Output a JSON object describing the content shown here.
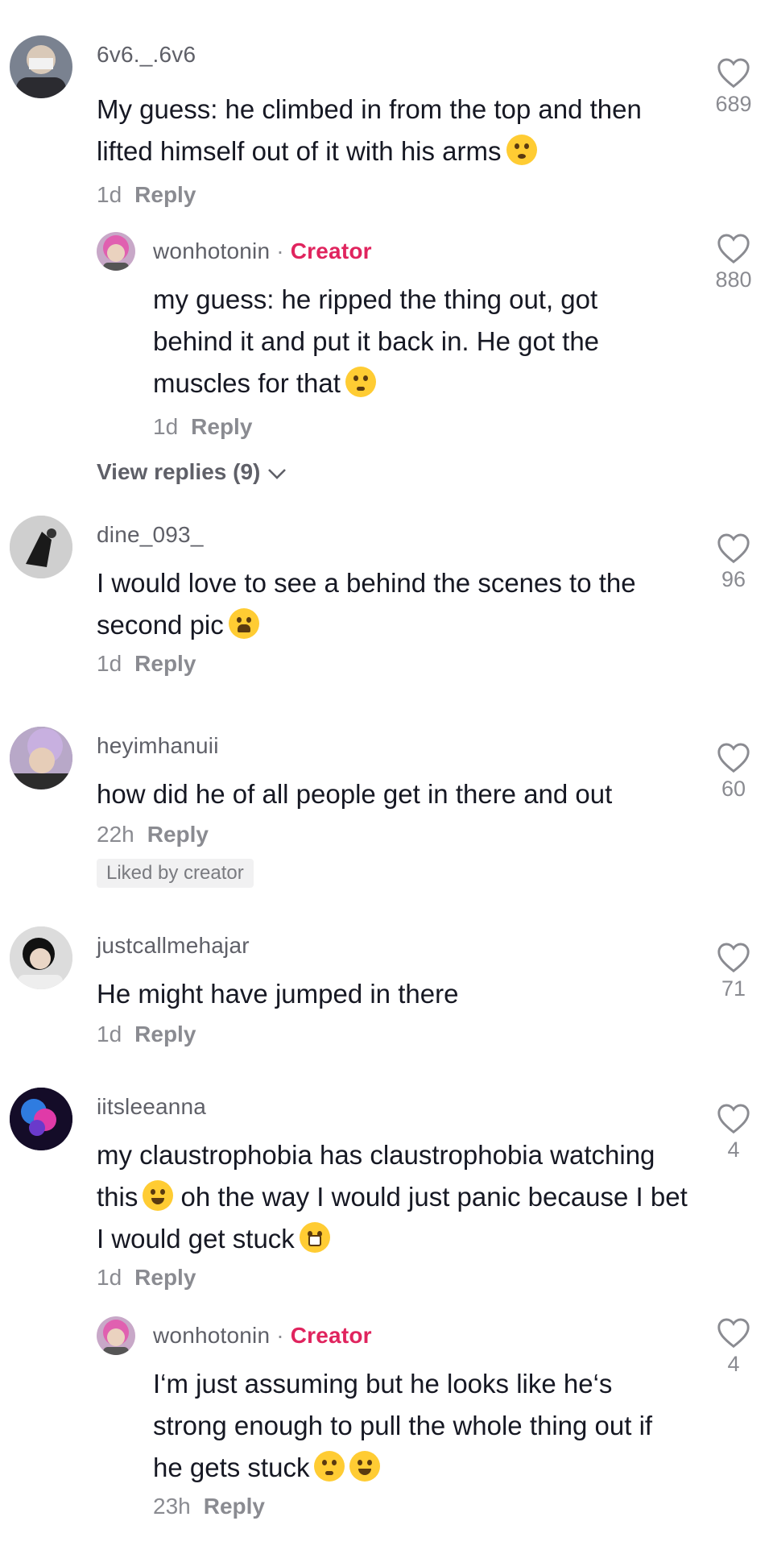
{
  "colors": {
    "creator": "#e0245e",
    "muted": "#8a8b91",
    "text": "#161823"
  },
  "comments": [
    {
      "username": "6v6._.6v6",
      "text": "My guess: he climbed in from the top and then lifted himself out of it with his arms",
      "emoji": "flushed-face",
      "time": "1d",
      "reply": "Reply",
      "likes": "689"
    },
    {
      "username": "wonhotonin",
      "creator_label": "Creator",
      "text": "my guess: he ripped the thing out, got behind it and put it back in. He got the muscles for that",
      "emoji": "thinking-face",
      "time": "1d",
      "reply": "Reply",
      "likes": "880"
    },
    {
      "view_replies": "View replies (9)"
    },
    {
      "username": "dine_093_",
      "text": "I would love to see a behind the scenes to the second pic",
      "emoji": "crying-face",
      "time": "1d",
      "reply": "Reply",
      "likes": "96"
    },
    {
      "username": "heyimhanuii",
      "text": "how did he of all people get in there and out",
      "time": "22h",
      "reply": "Reply",
      "likes": "60",
      "badge": "Liked by creator"
    },
    {
      "username": "justcallmehajar",
      "text": "He might have jumped in there",
      "time": "1d",
      "reply": "Reply",
      "likes": "71"
    },
    {
      "username": "iitsleeanna",
      "text_a": "my claustrophobia has claustrophobia watching this",
      "text_b": " oh the way I would just panic because I bet I would get stuck",
      "time": "1d",
      "reply": "Reply",
      "likes": "4"
    },
    {
      "username": "wonhotonin",
      "creator_label": "Creator",
      "text": "I‘m just assuming but he looks like he‘s strong enough to pull the whole thing out if he gets stuck",
      "time": "23h",
      "reply": "Reply",
      "likes": "4"
    }
  ]
}
